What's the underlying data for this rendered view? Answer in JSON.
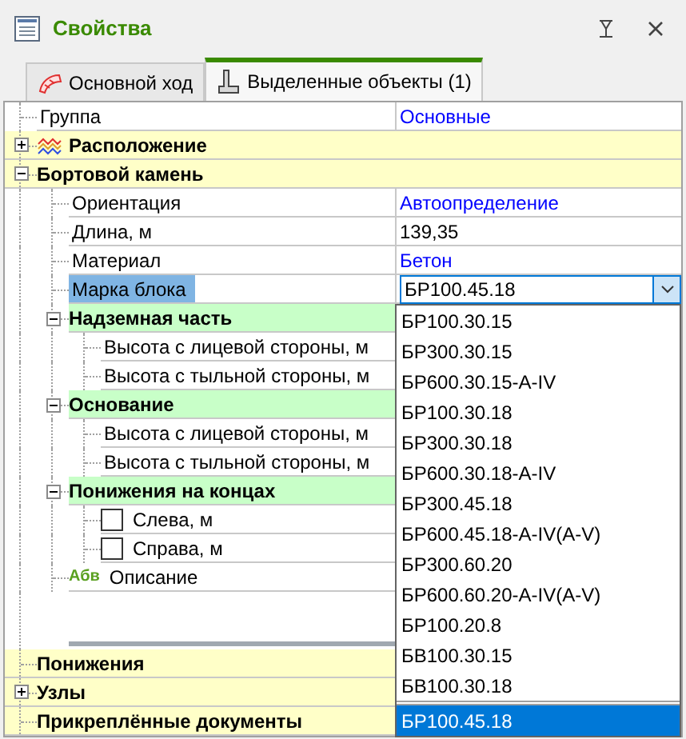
{
  "panel": {
    "title": "Свойства"
  },
  "tabs": [
    {
      "label": "Основной ход",
      "selected": false
    },
    {
      "label": "Выделенные объекты (1)",
      "selected": true
    }
  ],
  "rows": [
    {
      "kind": "choice",
      "label": "Группа",
      "value": "Основные",
      "selected": false
    },
    {
      "kind": "layers",
      "label": "Расположение",
      "expanded": false
    },
    {
      "kind": "category",
      "label": "Бортовой камень",
      "expanded": true,
      "children": [
        {
          "kind": "choice",
          "label": "Ориентация",
          "value": "Автоопределение",
          "selected": false
        },
        {
          "kind": "number",
          "label": "Длина, м",
          "value": "139,35",
          "selected": false
        },
        {
          "kind": "choice",
          "label": "Материал",
          "value": "Бетон",
          "selected": false
        },
        {
          "kind": "dropdown",
          "label": "Марка блока",
          "value": "БР100.45.18",
          "selected": true,
          "expanded": true,
          "options": [
            {
              "label": "БР100.30.15",
              "selected": false
            },
            {
              "label": "БР300.30.15",
              "selected": false
            },
            {
              "label": "БР600.30.15-А-IV",
              "selected": false
            },
            {
              "label": "БР100.30.18",
              "selected": false
            },
            {
              "label": "БР300.30.18",
              "selected": false
            },
            {
              "label": "БР600.30.18-А-IV",
              "selected": false
            },
            {
              "label": "БР300.45.18",
              "selected": false
            },
            {
              "label": "БР600.45.18-А-IV(А-V)",
              "selected": false
            },
            {
              "label": "БР300.60.20",
              "selected": false
            },
            {
              "label": "БР600.60.20-А-IV(А-V)",
              "selected": false
            },
            {
              "label": "БР100.20.8",
              "selected": false
            },
            {
              "label": "БВ100.30.15",
              "selected": false
            },
            {
              "label": "БВ100.30.18",
              "selected": false
            },
            {
              "label": "БР100.45.18",
              "selected": true
            }
          ]
        },
        {
          "kind": "subcategory",
          "label": "Надземная часть",
          "expanded": true,
          "children": [
            {
              "kind": "property",
              "label": "Высота с лицевой стороны, м",
              "selected": false
            },
            {
              "kind": "property",
              "label": "Высота с тыльной стороны, м",
              "selected": false
            }
          ]
        },
        {
          "kind": "subcategory",
          "label": "Основание",
          "expanded": true,
          "children": [
            {
              "kind": "property",
              "label": "Высота с лицевой стороны, м",
              "selected": false
            },
            {
              "kind": "property",
              "label": "Высота с тыльной стороны, м",
              "selected": false
            }
          ]
        },
        {
          "kind": "subcategory",
          "label": "Понижения на концах",
          "expanded": true,
          "children": [
            {
              "kind": "checkbox",
              "label": "Слева, м",
              "checked": false,
              "selected": false
            },
            {
              "kind": "checkbox",
              "label": "Справа, м",
              "checked": false,
              "selected": false
            }
          ]
        },
        {
          "kind": "text",
          "icon_text": "Абв",
          "label": "Описание",
          "selected": false
        }
      ]
    }
  ],
  "bottom_rows": [
    {
      "kind": "category",
      "label": "Понижения"
    },
    {
      "kind": "category",
      "label": "Узлы",
      "expanded": false
    },
    {
      "kind": "category",
      "label": "Прикреплённые документы"
    }
  ]
}
